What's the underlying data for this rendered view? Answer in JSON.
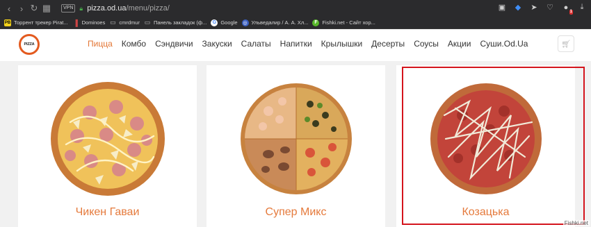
{
  "browser": {
    "vpn_label": "VPN",
    "url_domain": "pizza.od.ua",
    "url_path": "/menu/pizza/",
    "ext_badge": "1",
    "bookmarks": [
      {
        "label": "Торрент трекер Pirat...",
        "icon": "pirate-bay-icon"
      },
      {
        "label": "Dominoes",
        "icon": "dominoes-icon"
      },
      {
        "label": "cmrdmur",
        "icon": "folder-icon"
      },
      {
        "label": "Панель закладок (ф...",
        "icon": "folder-icon"
      },
      {
        "label": "Google",
        "icon": "google-icon"
      },
      {
        "label": "Ульведалир / А. А. Хл...",
        "icon": "globe-icon"
      },
      {
        "label": "Fishki.net - Сайт хор...",
        "icon": "fishki-icon"
      }
    ]
  },
  "site": {
    "logo_text": "PIZZA",
    "menu": [
      {
        "label": "Пицца",
        "active": true
      },
      {
        "label": "Комбо"
      },
      {
        "label": "Сэндвичи"
      },
      {
        "label": "Закуски"
      },
      {
        "label": "Салаты"
      },
      {
        "label": "Напитки"
      },
      {
        "label": "Крылышки"
      },
      {
        "label": "Десерты"
      },
      {
        "label": "Соусы"
      },
      {
        "label": "Акции"
      },
      {
        "label": "Суши.Od.Ua"
      }
    ],
    "accent_color": "#e57a3c"
  },
  "products": [
    {
      "name": "Чикен Гаваи"
    },
    {
      "name": "Супер Микс"
    },
    {
      "name": "Козацька"
    }
  ],
  "watermark": "Fishki.net"
}
